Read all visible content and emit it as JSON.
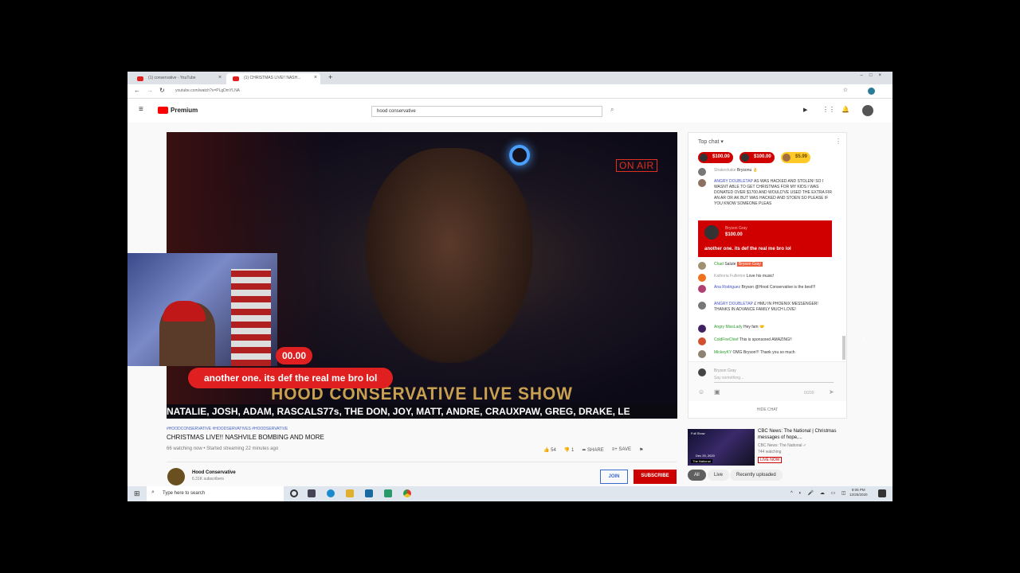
{
  "browser": {
    "tabs": [
      {
        "label": "(1) conservative - YouTube"
      },
      {
        "label": "(1) CHRISTMAS LIVE!! NASH..."
      }
    ],
    "url": "youtube.com/watch?v=PLgDmYLNA"
  },
  "youtube": {
    "logo": "Premium",
    "search_value": "hood conservative"
  },
  "video": {
    "on_air": "ON AIR",
    "show_title": "HOOD CONSERVATIVE LIVE SHOW",
    "ticker": "NATALIE, JOSH, ADAM, RASCALS77s, THE DON, JOY, MATT, ANDRE, CRAUXPAW, GREG, DRAKE, LE",
    "amount_bubble": "00.00",
    "alert_bubble": "another one. its def the real me bro lol"
  },
  "info": {
    "hashtags": "#HOODCONSERVATIVE #HOODSERVATIVES #HOODSERVATIVE",
    "title": "CHRISTMAS LIVE!! NASHVILE BOMBING AND MORE",
    "meta": "66 watching now • Started streaming 22 minutes ago",
    "likes": "54",
    "dislikes": "1",
    "share": "SHARE",
    "save": "SAVE",
    "channel": "Hood Conservative",
    "subscribers": "6.31K subscribers",
    "join": "JOIN",
    "subscribe": "SUBSCRIBE"
  },
  "chat": {
    "header": "Top chat ▾",
    "pills": [
      "$100.00",
      "$100.00",
      "$5.99"
    ],
    "messages": [
      {
        "name": "Shakeshake",
        "text": "Brysonu 👌"
      },
      {
        "name": "ANGRY DOUBLETAP",
        "text": "AS WAS HACKED AND STOLEN! SO I WASNT ABLE TO GET CHRISTMAS FOR MY KIDS I WAS DONATED OVER $1700 AND WOULD'VE USED THE EXTRA FIR AN AR OR AK BUT WAS HACKED AND STOEN SO PLEASE IF YOU KNOW SOMEONE PLEAS"
      },
      {
        "name": "Chad",
        "text": "Salute",
        "tag": "Bryson Gray"
      },
      {
        "name": "Kathoria Fullerton",
        "text": "Love his music!"
      },
      {
        "name": "Ana Rodriguez",
        "text": "Bryson @Hood Conservative is the best!!!"
      },
      {
        "name": "ANGRY DOUBLETAP",
        "text": "£ HMU IN PHOENIX MESSENGER! THANKS IN ADVANCE FAMILY MUCH LOVE!"
      },
      {
        "name": "Angry MissLady",
        "text": "Hey fam 🤝"
      },
      {
        "name": "ColdFireChief",
        "text": "This is sponsored AMAZING!!"
      },
      {
        "name": "MickeyKY",
        "text": "OMG Bryson!!! Thank you so much"
      }
    ],
    "superchat": {
      "name": "Bryson Gray",
      "amount": "$100.00",
      "text": "another one. its def the real me bro lol"
    },
    "input_user": "Bryson Gray",
    "input_placeholder": "Say something...",
    "counter": "0/200",
    "hide": "HIDE CHAT"
  },
  "related": {
    "title": "CBC News: The National | Christmas messages of hope,...",
    "channel": "CBC News: The National ✓",
    "watching": "744 watching",
    "badge": "LIVE NOW",
    "thumb_label": "Full Show",
    "thumb_date": "Dec 25, 2020",
    "thumb_brand": "The National"
  },
  "filters": [
    "All",
    "Live",
    "Recently uploaded"
  ],
  "taskbar": {
    "search": "Type here to search",
    "time": "9:05 PM",
    "date": "12/25/2020"
  }
}
